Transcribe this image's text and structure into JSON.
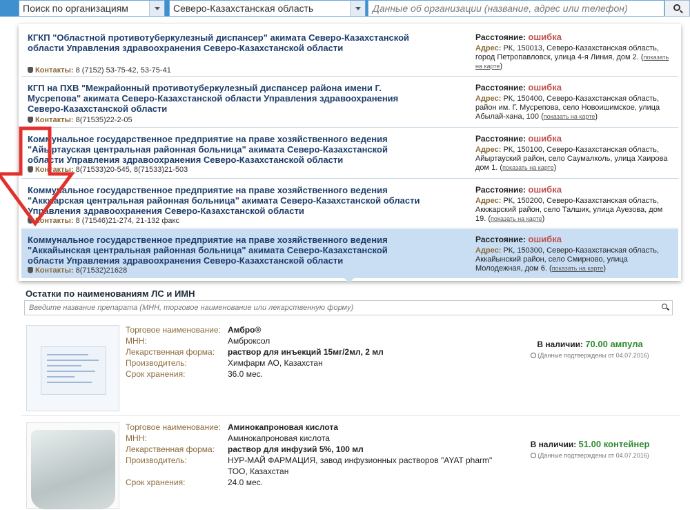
{
  "topbar": {
    "org_select": "Поиск по организациям",
    "region_select": "Северо-Казахстанская область",
    "search_placeholder": "Данные об организации (название, адрес или телефон)"
  },
  "labels": {
    "contacts": "Контакты:",
    "distance": "Расстояние:",
    "address": "Адрес:",
    "show_on_map": "показать на карте"
  },
  "organizations": [
    {
      "name": "КГКП \"Областной противотуберкулезный диспансер\" акимата Северо-Казахстанской области Управления здравоохранения Северо-Казахстанской области",
      "contacts": "8 (7152) 53-75-42, 53-75-41",
      "distance": "ошибка",
      "address": "РК, 150013, Северо-Казахстанская область, город Петропавловск, улица 4-я Линия, дом 2."
    },
    {
      "name": "КГП на ПХВ \"Межрайонный противотуберкулезный диспансер района имени Г. Мусрепова\" акимата Северо-Казахстанской области Управления здравоохранения Северо-Казахстанской области",
      "contacts": "8(71535)22-2-05",
      "distance": "ошибка",
      "address": "РК, 150400, Северо-Казахстанская область, район им. Г. Мусрепова, село Новоишимское, улица Абылай-хана, 100"
    },
    {
      "name": "Коммунальное государственное предприятие на праве хозяйственного ведения \"Айыртауская центральная районная больница\" акимата Северо-Казахстанской области Управления здравоохранения Северо-Казахстанской области",
      "contacts": "8(71533)20-545, 8(71533)21-503",
      "distance": "ошибка",
      "address": "РК, 150100, Северо-Казахстанская область, Айыртауский район, село Саумалколь, улица Хаирова дом 1."
    },
    {
      "name": "Коммунальное государственное предприятие на праве хозяйственного ведения \"Аккжарская центральная районная больница\" акимата Северо-Казахстанской области Управления здравоохранения Северо-Казахстанской области",
      "contacts": "8 (71546)21-274, 21-132 факс",
      "distance": "ошибка",
      "address": "РК, 150200, Северо-Казахстанская область, Аккжарский район, село Талшик, улица Ауезова, дом 19."
    },
    {
      "name": "Коммунальное государственное предприятие на праве хозяйственного ведения \"Аккайынская центральная районная больница\" акимата Северо-Казахстанской области Управления здравоохранения Северо-Казахстанской области",
      "contacts": "8(71532)21628",
      "distance": "ошибка",
      "address": "РК, 150300, Северо-Казахстанская область, Аккайынский район, село Смирново, улица Молодежная, дом 6."
    }
  ],
  "drugs_section": {
    "title": "Остатки по наименованиям ЛС и ИМН",
    "search_placeholder": "Введите название препарата (МНН, торговое наименование или лекарственную форму)"
  },
  "drug_labels": {
    "trade_name": "Торговое наименование:",
    "inn": "МНН:",
    "form": "Лекарственная форма:",
    "manufacturer": "Производитель:",
    "shelf_life": "Срок хранения:",
    "in_stock": "В наличии:",
    "confirmed": "(Данные подтверждены от 04.07.2016)"
  },
  "drugs": [
    {
      "trade_name": "Амбро®",
      "inn": "Амброксол",
      "form": "раствор для инъекций 15мг/2мл, 2 мл",
      "manufacturer": "Химфарм АО, Казахстан",
      "shelf_life": "36.0 мес.",
      "stock": "70.00 ампула"
    },
    {
      "trade_name": "Аминокапроновая кислота",
      "inn": "Аминокапроновая кислота",
      "form": "раствор для инфузий 5%, 100 мл",
      "manufacturer": "НУР-МАЙ ФАРМАЦИЯ, завод инфузионных растворов \"AYAT pharm\" ТОО, Казахстан",
      "shelf_life": "24.0 мес.",
      "stock": "51.00 контейнер"
    }
  ],
  "colors": {
    "topbar": "#3f90cf",
    "active_row": "#c9ddf3",
    "error": "#c0504d",
    "stock_green": "#2f8a2f",
    "annotation_arrow": "#e0312d"
  }
}
